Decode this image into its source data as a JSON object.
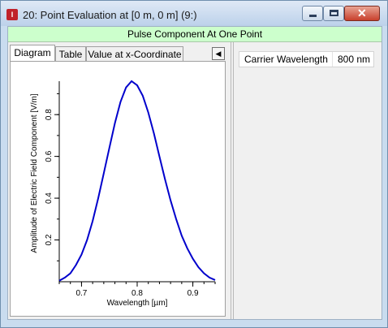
{
  "window": {
    "title": "20: Point Evaluation at [0 m, 0 m] (9:)",
    "icon": "app-icon",
    "controls": {
      "minimize": "minimize-icon",
      "maximize": "maximize-icon",
      "close": "close-icon"
    }
  },
  "header": {
    "title": "Pulse Component At One Point"
  },
  "tabs": [
    {
      "label": "Diagram",
      "active": true
    },
    {
      "label": "Table",
      "active": false
    },
    {
      "label": "Value at x-Coordinate",
      "active": false
    }
  ],
  "tab_scroll_icon": "triangle-left-icon",
  "properties": [
    {
      "name": "Carrier Wavelength",
      "value": "800 nm"
    }
  ],
  "colors": {
    "curve": "#0000cc",
    "header_bg": "#ccffcc"
  },
  "chart_data": {
    "type": "line",
    "xlabel": "Wavelength [µm]",
    "ylabel": "Amplitude of Electric Field Component [V/m]",
    "xlim": [
      0.66,
      0.94
    ],
    "ylim": [
      0,
      0.96
    ],
    "xticks": [
      "0.7",
      "0.8",
      "0.9"
    ],
    "yticks": [
      "0.2",
      "0.4",
      "0.6",
      "0.8"
    ],
    "grid": false,
    "series": [
      {
        "x": [
          0.66,
          0.67,
          0.68,
          0.69,
          0.7,
          0.71,
          0.72,
          0.73,
          0.74,
          0.75,
          0.76,
          0.77,
          0.78,
          0.79,
          0.8,
          0.81,
          0.82,
          0.83,
          0.84,
          0.85,
          0.86,
          0.87,
          0.88,
          0.89,
          0.9,
          0.91,
          0.92,
          0.93,
          0.94
        ],
        "y": [
          0.005,
          0.02,
          0.04,
          0.08,
          0.13,
          0.2,
          0.29,
          0.4,
          0.52,
          0.64,
          0.76,
          0.86,
          0.93,
          0.96,
          0.94,
          0.89,
          0.81,
          0.71,
          0.6,
          0.49,
          0.39,
          0.3,
          0.22,
          0.16,
          0.11,
          0.07,
          0.04,
          0.02,
          0.008
        ]
      }
    ]
  }
}
